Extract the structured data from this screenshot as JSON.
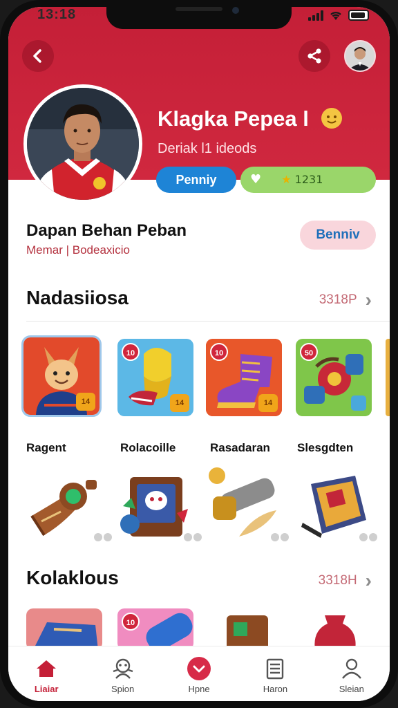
{
  "status": {
    "time": "13:18"
  },
  "header": {
    "back_icon": "back-arrow-icon",
    "share_icon": "share-icon"
  },
  "profile": {
    "name": "Klagka Pepea l",
    "subtitle": "Deriak l1 ideods",
    "tag_blue": "Penniy",
    "tag_green_value": "1231"
  },
  "info": {
    "title": "Dapan Behan Peban",
    "meta": "Memar | Bodeaxicio",
    "action_label": "Benniv"
  },
  "sections": [
    {
      "heading": "Nadasiiosa",
      "see_all": "3318P",
      "cards": [
        {
          "label": "Ragent",
          "badge": "",
          "corner": "14",
          "bg": "#e24a2b"
        },
        {
          "label": "Rolacoille",
          "badge": "10",
          "corner": "14",
          "bg": "#5cb8e6"
        },
        {
          "label": "Rasadaran",
          "badge": "10",
          "corner": "14",
          "bg": "#e8572a"
        },
        {
          "label": "Slesgdten",
          "badge": "50",
          "corner": "",
          "bg": "#7fc64a"
        }
      ]
    },
    {
      "heading": "Kolaklous",
      "see_all": "3318H"
    }
  ],
  "bottom_partial_badges": [
    "10",
    "10"
  ],
  "tabs": [
    {
      "label": "Liaiar",
      "icon": "home-icon",
      "active": true
    },
    {
      "label": "Spion",
      "icon": "robot-icon",
      "active": false
    },
    {
      "label": "Hpne",
      "icon": "heart-icon",
      "active": false
    },
    {
      "label": "Haron",
      "icon": "document-icon",
      "active": false
    },
    {
      "label": "Sleian",
      "icon": "user-icon",
      "active": false
    }
  ],
  "colors": {
    "brand_red": "#c41f37",
    "blue": "#1e84d6",
    "green": "#9ad66a",
    "pink": "#f9d6dc"
  }
}
